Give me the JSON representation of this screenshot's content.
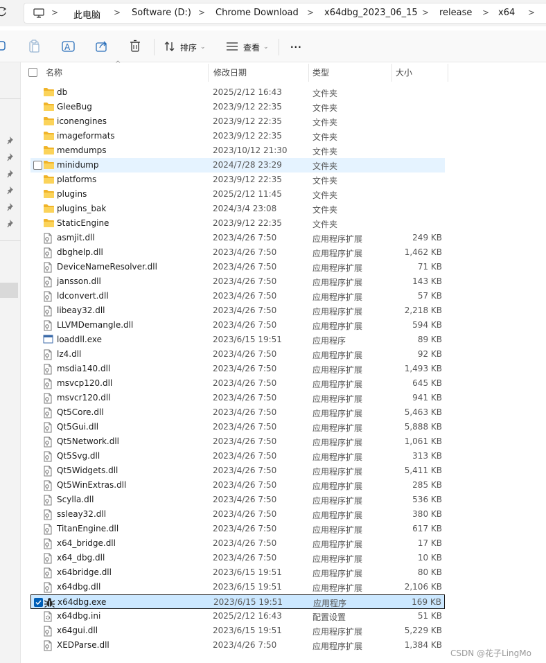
{
  "breadcrumbs": [
    "此电脑",
    "Software (D:)",
    "Chrome Download",
    "x64dbg_2023_06_15",
    "release",
    "x64"
  ],
  "toolbar": {
    "sort_label": "排序",
    "view_label": "查看",
    "more_label": "..."
  },
  "columns": {
    "name": "名称",
    "date": "修改日期",
    "type": "类型",
    "size": "大小"
  },
  "rows": [
    {
      "icon": "folder-icon",
      "name": "db",
      "date": "2025/2/12 16:43",
      "type": "文件夹",
      "size": ""
    },
    {
      "icon": "folder-icon",
      "name": "GleeBug",
      "date": "2023/9/12 22:35",
      "type": "文件夹",
      "size": ""
    },
    {
      "icon": "folder-icon",
      "name": "iconengines",
      "date": "2023/9/12 22:35",
      "type": "文件夹",
      "size": ""
    },
    {
      "icon": "folder-icon",
      "name": "imageformats",
      "date": "2023/9/12 22:35",
      "type": "文件夹",
      "size": ""
    },
    {
      "icon": "folder-icon",
      "name": "memdumps",
      "date": "2023/10/12 21:30",
      "type": "文件夹",
      "size": ""
    },
    {
      "icon": "folder-icon",
      "name": "minidump",
      "date": "2024/7/28 23:29",
      "type": "文件夹",
      "size": "",
      "state": "hover"
    },
    {
      "icon": "folder-icon",
      "name": "platforms",
      "date": "2023/9/12 22:35",
      "type": "文件夹",
      "size": ""
    },
    {
      "icon": "folder-icon",
      "name": "plugins",
      "date": "2025/2/12 11:45",
      "type": "文件夹",
      "size": ""
    },
    {
      "icon": "folder-icon",
      "name": "plugins_bak",
      "date": "2024/3/4 23:08",
      "type": "文件夹",
      "size": ""
    },
    {
      "icon": "folder-icon",
      "name": "StaticEngine",
      "date": "2023/9/12 22:35",
      "type": "文件夹",
      "size": ""
    },
    {
      "icon": "dll-file-icon",
      "name": "asmjit.dll",
      "date": "2023/4/26 7:50",
      "type": "应用程序扩展",
      "size": "249 KB"
    },
    {
      "icon": "dll-file-icon",
      "name": "dbghelp.dll",
      "date": "2023/4/26 7:50",
      "type": "应用程序扩展",
      "size": "1,462 KB"
    },
    {
      "icon": "dll-file-icon",
      "name": "DeviceNameResolver.dll",
      "date": "2023/4/26 7:50",
      "type": "应用程序扩展",
      "size": "71 KB"
    },
    {
      "icon": "dll-file-icon",
      "name": "jansson.dll",
      "date": "2023/4/26 7:50",
      "type": "应用程序扩展",
      "size": "143 KB"
    },
    {
      "icon": "dll-file-icon",
      "name": "ldconvert.dll",
      "date": "2023/4/26 7:50",
      "type": "应用程序扩展",
      "size": "57 KB"
    },
    {
      "icon": "dll-file-icon",
      "name": "libeay32.dll",
      "date": "2023/4/26 7:50",
      "type": "应用程序扩展",
      "size": "2,218 KB"
    },
    {
      "icon": "dll-file-icon",
      "name": "LLVMDemangle.dll",
      "date": "2023/4/26 7:50",
      "type": "应用程序扩展",
      "size": "594 KB"
    },
    {
      "icon": "exe-window-icon",
      "name": "loaddll.exe",
      "date": "2023/6/15 19:51",
      "type": "应用程序",
      "size": "89 KB"
    },
    {
      "icon": "dll-file-icon",
      "name": "lz4.dll",
      "date": "2023/4/26 7:50",
      "type": "应用程序扩展",
      "size": "92 KB"
    },
    {
      "icon": "dll-file-icon",
      "name": "msdia140.dll",
      "date": "2023/4/26 7:50",
      "type": "应用程序扩展",
      "size": "1,493 KB"
    },
    {
      "icon": "dll-file-icon",
      "name": "msvcp120.dll",
      "date": "2023/4/26 7:50",
      "type": "应用程序扩展",
      "size": "645 KB"
    },
    {
      "icon": "dll-file-icon",
      "name": "msvcr120.dll",
      "date": "2023/4/26 7:50",
      "type": "应用程序扩展",
      "size": "941 KB"
    },
    {
      "icon": "dll-file-icon",
      "name": "Qt5Core.dll",
      "date": "2023/4/26 7:50",
      "type": "应用程序扩展",
      "size": "5,463 KB"
    },
    {
      "icon": "dll-file-icon",
      "name": "Qt5Gui.dll",
      "date": "2023/4/26 7:50",
      "type": "应用程序扩展",
      "size": "5,888 KB"
    },
    {
      "icon": "dll-file-icon",
      "name": "Qt5Network.dll",
      "date": "2023/4/26 7:50",
      "type": "应用程序扩展",
      "size": "1,061 KB"
    },
    {
      "icon": "dll-file-icon",
      "name": "Qt5Svg.dll",
      "date": "2023/4/26 7:50",
      "type": "应用程序扩展",
      "size": "313 KB"
    },
    {
      "icon": "dll-file-icon",
      "name": "Qt5Widgets.dll",
      "date": "2023/4/26 7:50",
      "type": "应用程序扩展",
      "size": "5,411 KB"
    },
    {
      "icon": "dll-file-icon",
      "name": "Qt5WinExtras.dll",
      "date": "2023/4/26 7:50",
      "type": "应用程序扩展",
      "size": "285 KB"
    },
    {
      "icon": "dll-file-icon",
      "name": "Scylla.dll",
      "date": "2023/4/26 7:50",
      "type": "应用程序扩展",
      "size": "536 KB"
    },
    {
      "icon": "dll-file-icon",
      "name": "ssleay32.dll",
      "date": "2023/4/26 7:50",
      "type": "应用程序扩展",
      "size": "380 KB"
    },
    {
      "icon": "dll-file-icon",
      "name": "TitanEngine.dll",
      "date": "2023/4/26 7:50",
      "type": "应用程序扩展",
      "size": "617 KB"
    },
    {
      "icon": "dll-file-icon",
      "name": "x64_bridge.dll",
      "date": "2023/4/26 7:50",
      "type": "应用程序扩展",
      "size": "17 KB"
    },
    {
      "icon": "dll-file-icon",
      "name": "x64_dbg.dll",
      "date": "2023/4/26 7:50",
      "type": "应用程序扩展",
      "size": "10 KB"
    },
    {
      "icon": "dll-file-icon",
      "name": "x64bridge.dll",
      "date": "2023/6/15 19:51",
      "type": "应用程序扩展",
      "size": "80 KB"
    },
    {
      "icon": "dll-file-icon",
      "name": "x64dbg.dll",
      "date": "2023/6/15 19:51",
      "type": "应用程序扩展",
      "size": "2,106 KB"
    },
    {
      "icon": "bug-icon",
      "name": "x64dbg.exe",
      "date": "2023/6/15 19:51",
      "type": "应用程序",
      "size": "169 KB",
      "state": "selected"
    },
    {
      "icon": "ini-file-icon",
      "name": "x64dbg.ini",
      "date": "2025/2/12 16:43",
      "type": "配置设置",
      "size": "51 KB"
    },
    {
      "icon": "dll-file-icon",
      "name": "x64gui.dll",
      "date": "2023/6/15 19:51",
      "type": "应用程序扩展",
      "size": "5,229 KB"
    },
    {
      "icon": "dll-file-icon",
      "name": "XEDParse.dll",
      "date": "2023/4/26 7:50",
      "type": "应用程序扩展",
      "size": "1,384 KB"
    }
  ],
  "watermark": "CSDN @花子LingMo",
  "colors": {
    "hover": "#e5f3ff",
    "selected": "#cce8ff",
    "accent": "#005fb8",
    "folder": "#f4c73b"
  }
}
